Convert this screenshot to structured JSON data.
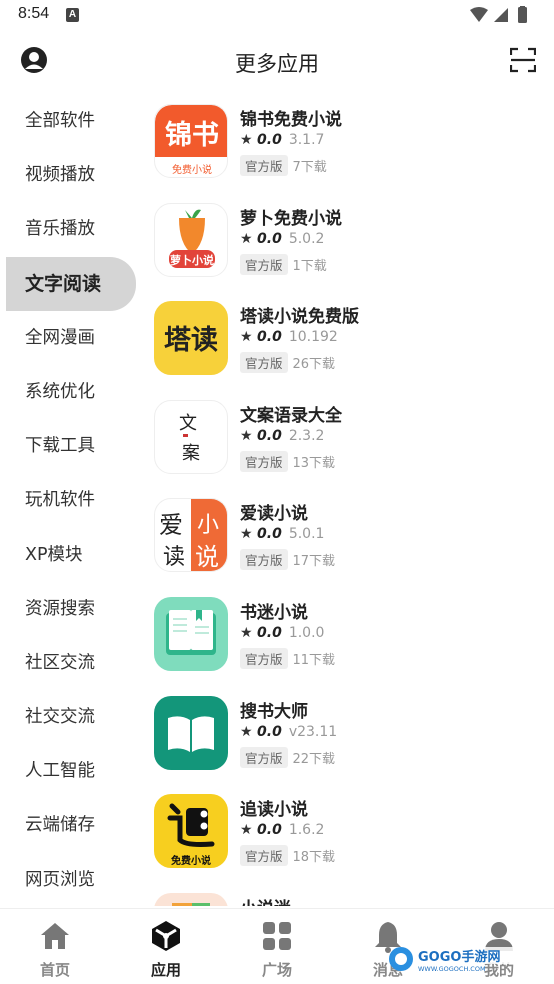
{
  "status": {
    "time": "8:54",
    "notif_letter": "A"
  },
  "topbar": {
    "title": "更多应用"
  },
  "sidebar": {
    "items": [
      {
        "label": "全部软件"
      },
      {
        "label": "视频播放"
      },
      {
        "label": "音乐播放"
      },
      {
        "label": "文字阅读",
        "active": true
      },
      {
        "label": "全网漫画"
      },
      {
        "label": "系统优化"
      },
      {
        "label": "下载工具"
      },
      {
        "label": "玩机软件"
      },
      {
        "label": "XP模块"
      },
      {
        "label": "资源搜索"
      },
      {
        "label": "社区交流"
      },
      {
        "label": "社交交流"
      },
      {
        "label": "人工智能"
      },
      {
        "label": "云端储存"
      },
      {
        "label": "网页浏览"
      }
    ]
  },
  "apps": [
    {
      "name": "锦书免费小说",
      "rating": "0.0",
      "version": "3.1.7",
      "badge": "官方版",
      "downloads": "7下载",
      "icon": "jinshu-icon",
      "icon_text": "锦书",
      "icon_sub": "免费小说"
    },
    {
      "name": "萝卜免费小说",
      "rating": "0.0",
      "version": "5.0.2",
      "badge": "官方版",
      "downloads": "1下载",
      "icon": "carrot-icon",
      "icon_text": "萝卜小说"
    },
    {
      "name": "塔读小说免费版",
      "rating": "0.0",
      "version": "10.192",
      "badge": "官方版",
      "downloads": "26下载",
      "icon": "tadu-icon",
      "icon_text": "塔读"
    },
    {
      "name": "文案语录大全",
      "rating": "0.0",
      "version": "2.3.2",
      "badge": "官方版",
      "downloads": "13下载",
      "icon": "wenan-icon",
      "icon_text_a": "文",
      "icon_text_b": "案"
    },
    {
      "name": "爱读小说",
      "rating": "0.0",
      "version": "5.0.1",
      "badge": "官方版",
      "downloads": "17下载",
      "icon": "aidu-icon",
      "icon_text_a": "爱",
      "icon_text_b": "读",
      "icon_text_c": "小",
      "icon_text_d": "说"
    },
    {
      "name": "书迷小说",
      "rating": "0.0",
      "version": "1.0.0",
      "badge": "官方版",
      "downloads": "11下载",
      "icon": "book-icon"
    },
    {
      "name": "搜书大师",
      "rating": "0.0",
      "version": "v23.11",
      "badge": "官方版",
      "downloads": "22下载",
      "icon": "open-book-icon"
    },
    {
      "name": "追读小说",
      "rating": "0.0",
      "version": "1.6.2",
      "badge": "官方版",
      "downloads": "18下载",
      "icon": "zhuidu-icon",
      "icon_sub": "免费小说"
    },
    {
      "name": "小说迷",
      "icon": "xiaoshuomi-icon"
    }
  ],
  "bottomnav": {
    "items": [
      {
        "label": "首页",
        "icon": "home-icon"
      },
      {
        "label": "应用",
        "icon": "apps-icon",
        "active": true
      },
      {
        "label": "广场",
        "icon": "grid-icon"
      },
      {
        "label": "消息",
        "icon": "bell-icon"
      },
      {
        "label": "我的",
        "icon": "person-icon"
      }
    ]
  },
  "watermark": {
    "text": "GOGO手游网",
    "url_text": "WWW.GOGOCH.COM"
  },
  "colors": {
    "accent_orange": "#f25a2c",
    "active_bg": "#d5d5d5",
    "muted": "#999999"
  }
}
